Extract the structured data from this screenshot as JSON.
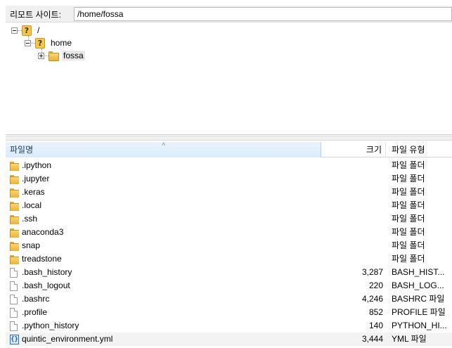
{
  "address_bar": {
    "label": "리모트 사이트:",
    "path": "/home/fossa"
  },
  "tree": {
    "root": "/",
    "home": "home",
    "fossa": "fossa",
    "icon_unknown": "?"
  },
  "list": {
    "columns": {
      "name": "파일명",
      "size": "크기",
      "type": "파일 유형"
    },
    "sort_indicator": "˄",
    "rows": [
      {
        "name": ".ipython",
        "size": "",
        "type": "파일 폴더",
        "icon": "folder-icon"
      },
      {
        "name": ".jupyter",
        "size": "",
        "type": "파일 폴더",
        "icon": "folder-icon"
      },
      {
        "name": ".keras",
        "size": "",
        "type": "파일 폴더",
        "icon": "folder-icon"
      },
      {
        "name": ".local",
        "size": "",
        "type": "파일 폴더",
        "icon": "folder-icon"
      },
      {
        "name": ".ssh",
        "size": "",
        "type": "파일 폴더",
        "icon": "folder-icon"
      },
      {
        "name": "anaconda3",
        "size": "",
        "type": "파일 폴더",
        "icon": "folder-icon"
      },
      {
        "name": "snap",
        "size": "",
        "type": "파일 폴더",
        "icon": "folder-icon"
      },
      {
        "name": "treadstone",
        "size": "",
        "type": "파일 폴더",
        "icon": "folder-icon"
      },
      {
        "name": ".bash_history",
        "size": "3,287",
        "type": "BASH_HIST...",
        "icon": "file-icon"
      },
      {
        "name": ".bash_logout",
        "size": "220",
        "type": "BASH_LOG...",
        "icon": "file-icon"
      },
      {
        "name": ".bashrc",
        "size": "4,246",
        "type": "BASHRC 파일",
        "icon": "file-icon"
      },
      {
        "name": ".profile",
        "size": "852",
        "type": "PROFILE 파일",
        "icon": "file-icon"
      },
      {
        "name": ".python_history",
        "size": "140",
        "type": "PYTHON_HI...",
        "icon": "file-icon"
      },
      {
        "name": "quintic_environment.yml",
        "size": "3,444",
        "type": "YML 파일",
        "icon": "yml-file-icon"
      }
    ]
  }
}
